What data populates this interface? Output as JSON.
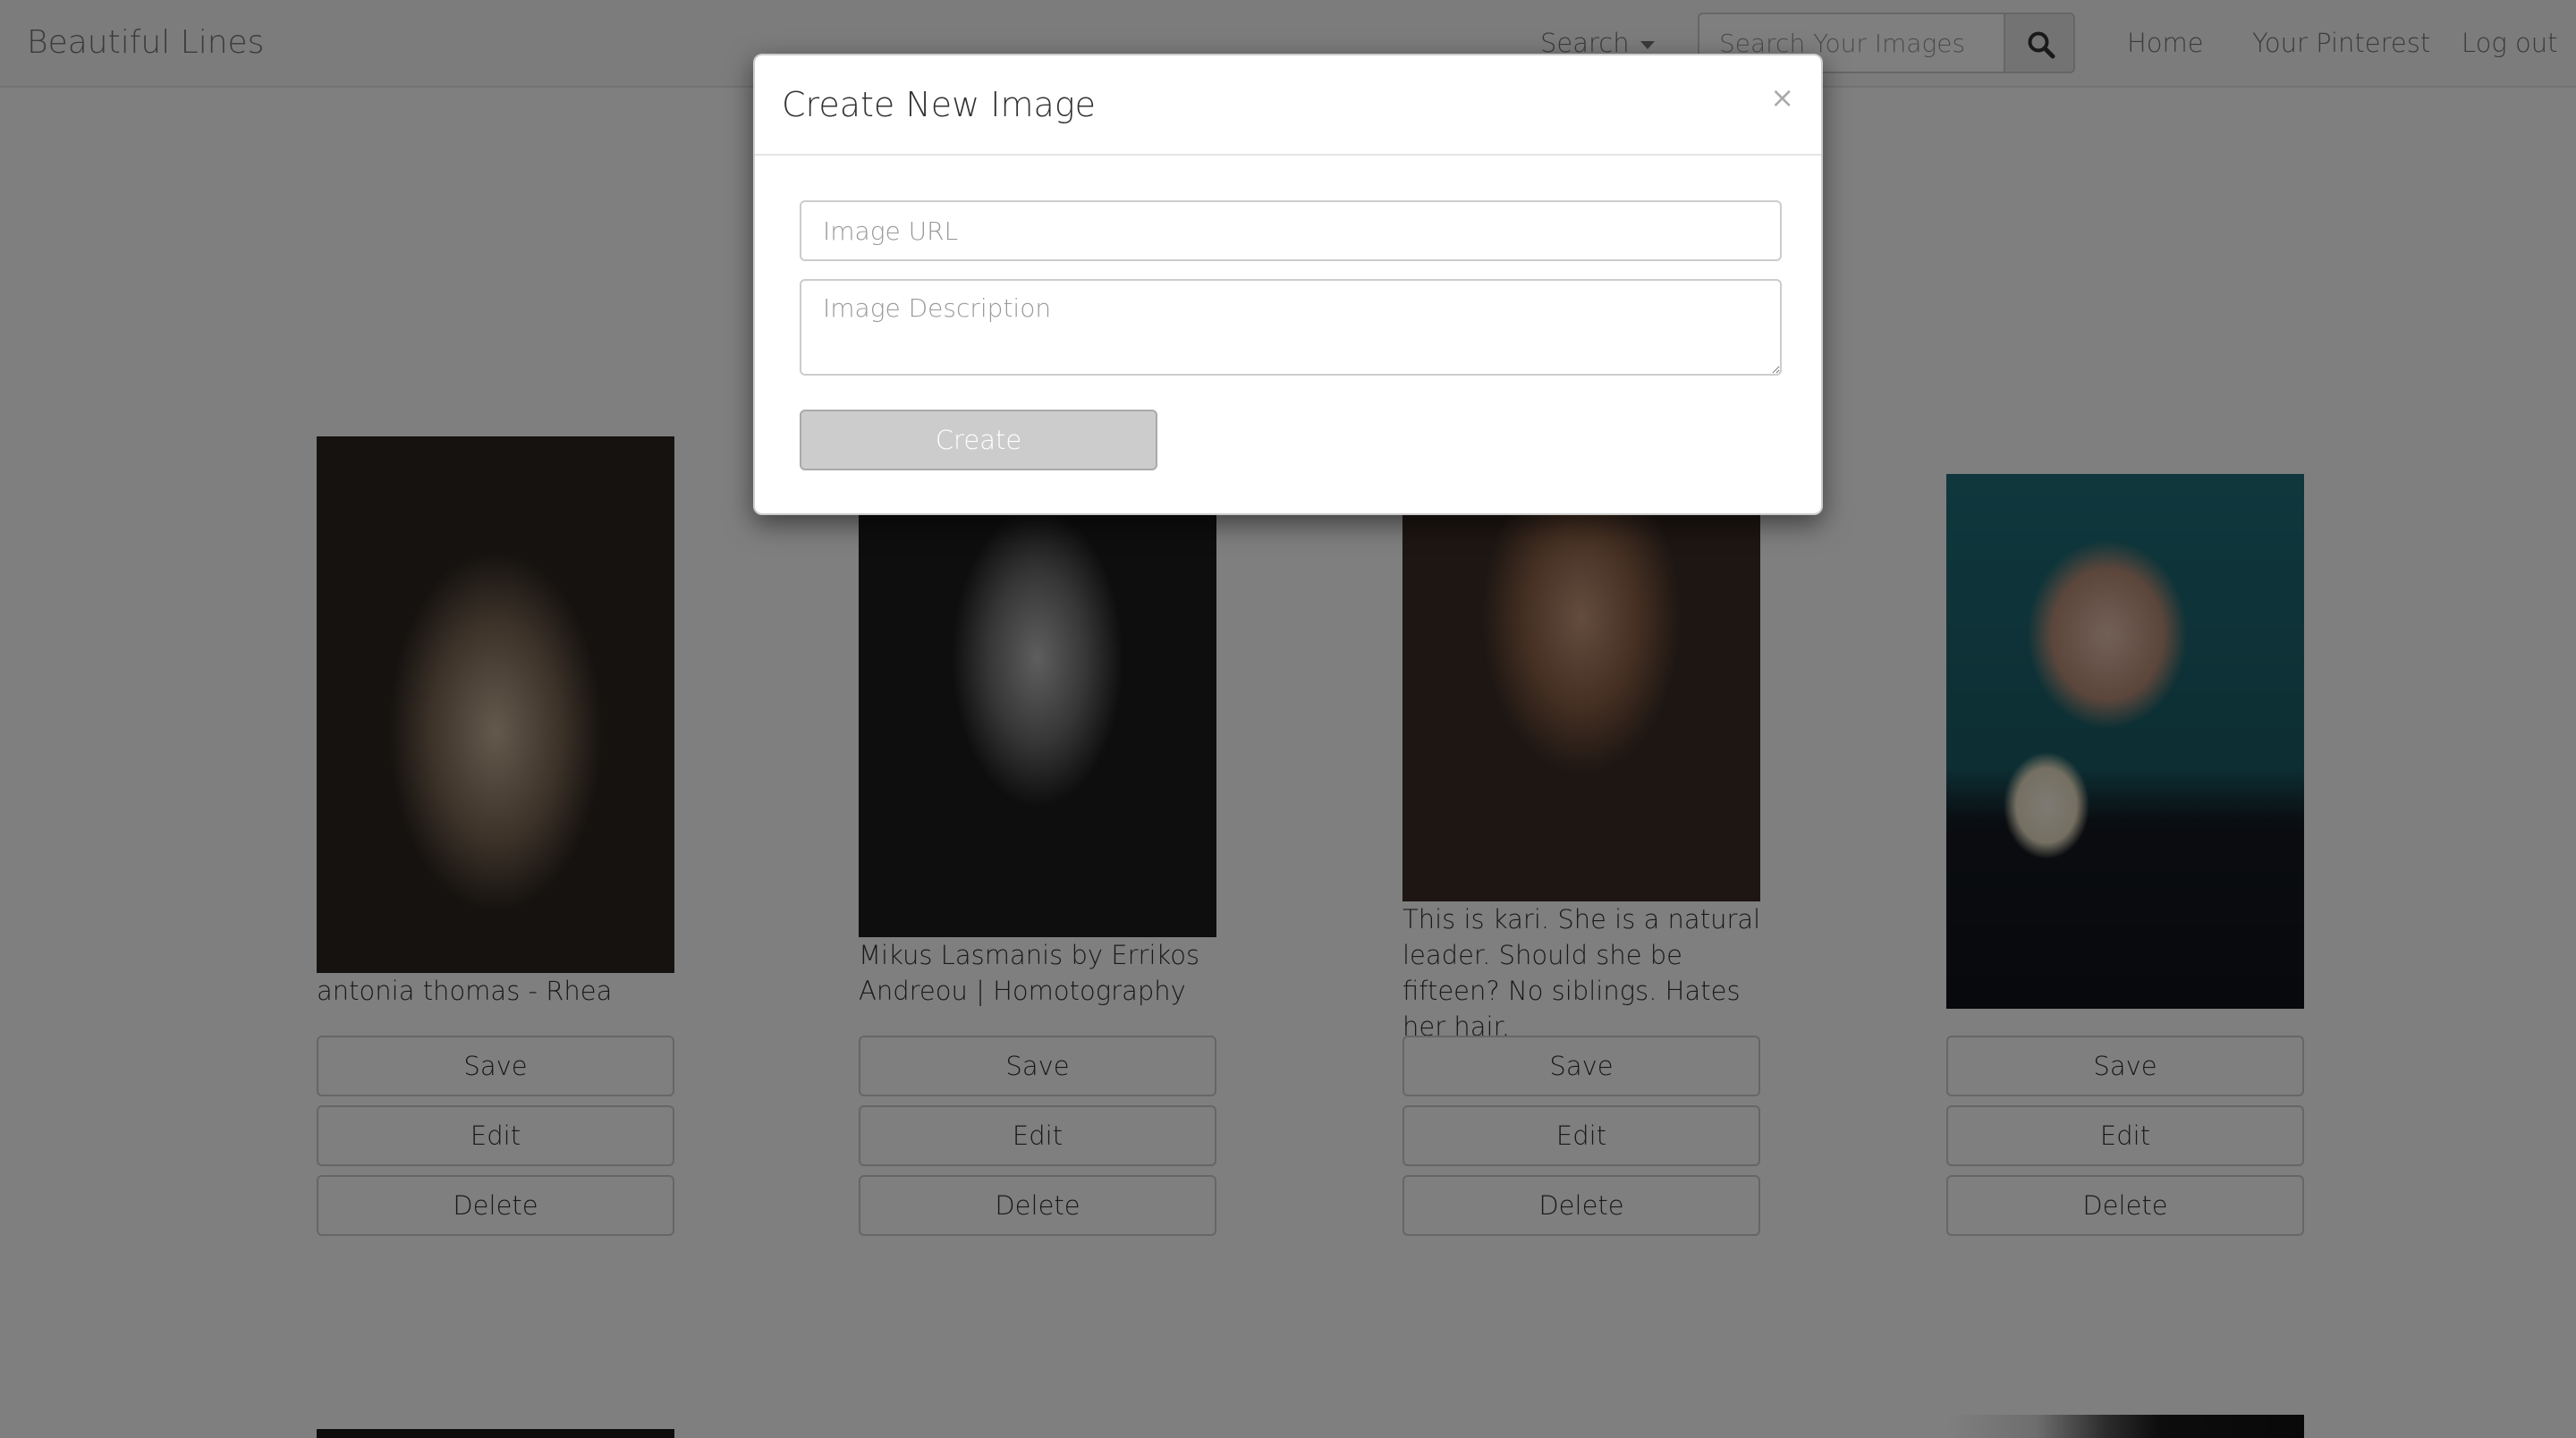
{
  "navbar": {
    "brand": "Beautiful Lines",
    "search_dropdown": "Search",
    "search_placeholder": "Search Your Images",
    "links": {
      "home": "Home",
      "your_pinterest": "Your Pinterest",
      "log_out": "Log out"
    }
  },
  "cards": [
    {
      "caption": "antonia thomas - Rhea",
      "save": "Save",
      "edit": "Edit",
      "delete": "Delete"
    },
    {
      "caption": "Mikus Lasmanis by Errikos Andreou | Homotography",
      "save": "Save",
      "edit": "Edit",
      "delete": "Delete"
    },
    {
      "caption": "This is kari. She is a natural leader. Should she be fifteen? No siblings. Hates her hair.",
      "save": "Save",
      "edit": "Edit",
      "delete": "Delete"
    },
    {
      "caption": "",
      "save": "Save",
      "edit": "Edit",
      "delete": "Delete"
    }
  ],
  "modal": {
    "title": "Create New Image",
    "close": "×",
    "url_placeholder": "Image URL",
    "description_placeholder": "Image Description",
    "create_label": "Create"
  },
  "colors": {
    "navbar_bg": "#f8f8f8",
    "backdrop": "rgba(0,0,0,0.5)",
    "modal_bg": "#ffffff"
  }
}
